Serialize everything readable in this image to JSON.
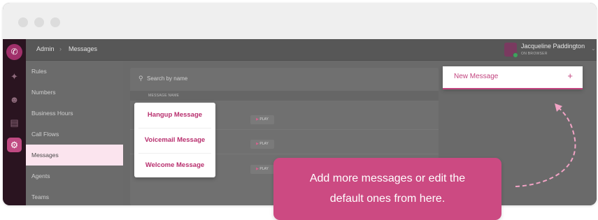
{
  "window": {
    "controls": [
      "close",
      "minimize",
      "maximize"
    ]
  },
  "rail": {
    "icons": [
      "phone-icon",
      "bolt-icon",
      "people-icon",
      "card-icon",
      "gear-icon"
    ]
  },
  "breadcrumb": {
    "root": "Admin",
    "separator": "›",
    "current": "Messages"
  },
  "user": {
    "name": "Jacqueline Paddington",
    "status": "ON BROWSER",
    "chevron": "⌄"
  },
  "sidebar": {
    "items": [
      {
        "label": "Rules",
        "active": false
      },
      {
        "label": "Numbers",
        "active": false
      },
      {
        "label": "Business Hours",
        "active": false
      },
      {
        "label": "Call Flows",
        "active": false
      },
      {
        "label": "Messages",
        "active": true
      },
      {
        "label": "Agents",
        "active": false
      },
      {
        "label": "Teams",
        "active": false
      }
    ]
  },
  "search": {
    "placeholder": "Search by name"
  },
  "table": {
    "column_header": "MESSAGE NAME",
    "play_label": "PLAY",
    "rows": [
      {
        "name": "Hangup Message"
      },
      {
        "name": "Voicemail Message"
      },
      {
        "name": "Welcome Message"
      }
    ]
  },
  "new_message": {
    "label": "New Message",
    "icon": "+"
  },
  "tooltip": {
    "line1": "Add more messages or edit the",
    "line2": "default ones from here."
  },
  "colors": {
    "accent": "#cc4a82",
    "rail": "#2a1420",
    "active_nav": "#fbe4ee"
  }
}
